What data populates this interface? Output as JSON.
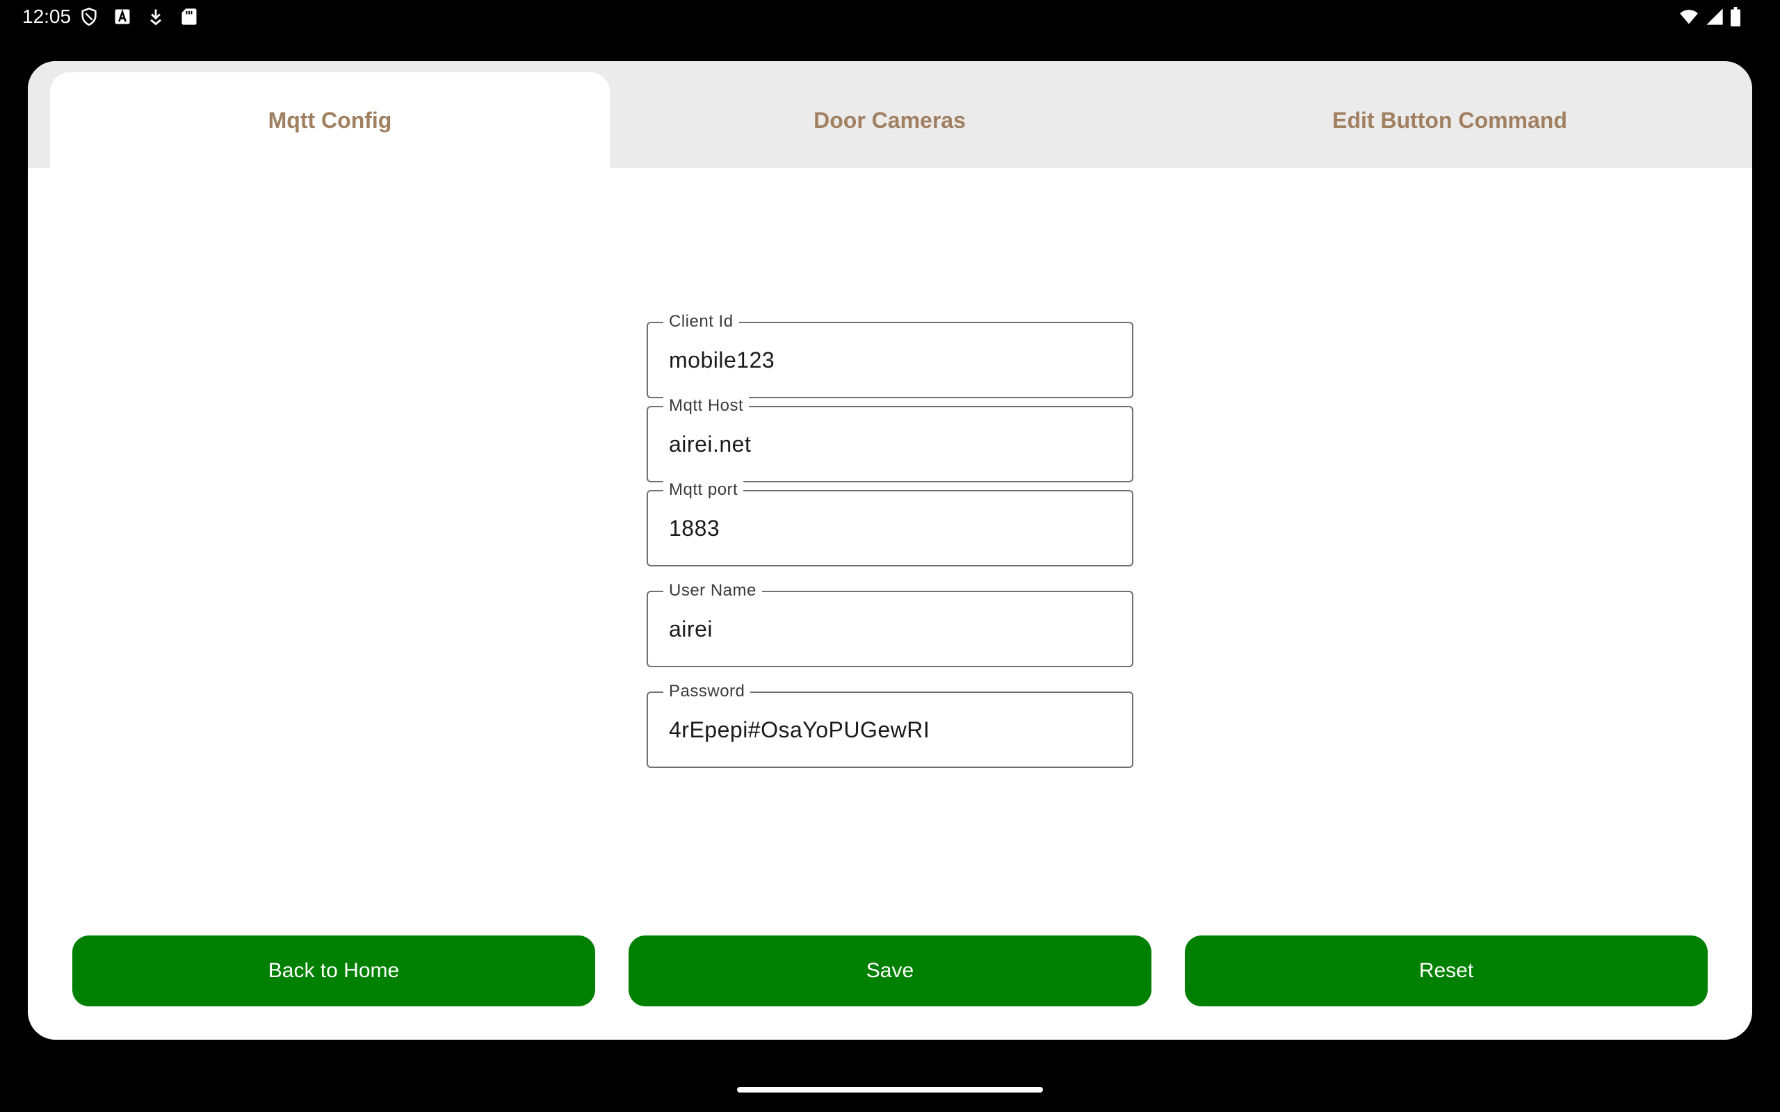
{
  "status_bar": {
    "time": "12:05",
    "icons_left": [
      "shield-icon",
      "font-a-icon",
      "download-icon",
      "sd-card-icon"
    ],
    "icons_right": [
      "wifi-icon",
      "cellular-signal-icon",
      "battery-icon"
    ]
  },
  "tabs": [
    {
      "label": "Mqtt Config",
      "active": true
    },
    {
      "label": "Door Cameras",
      "active": false
    },
    {
      "label": "Edit Button Command",
      "active": false
    }
  ],
  "form": {
    "client_id": {
      "label": "Client Id",
      "value": "mobile123"
    },
    "mqtt_host": {
      "label": "Mqtt Host",
      "value": "airei.net"
    },
    "mqtt_port": {
      "label": "Mqtt port",
      "value": "1883"
    },
    "user_name": {
      "label": "User Name",
      "value": "airei"
    },
    "password": {
      "label": "Password",
      "value": "4rEpepi#OsaYoPUGewRI"
    }
  },
  "buttons": {
    "back_label": "Back to Home",
    "save_label": "Save",
    "reset_label": "Reset"
  },
  "colors": {
    "accent_tab_text": "#a08060",
    "button_green": "#008000",
    "tab_strip_bg": "#ebebeb"
  }
}
